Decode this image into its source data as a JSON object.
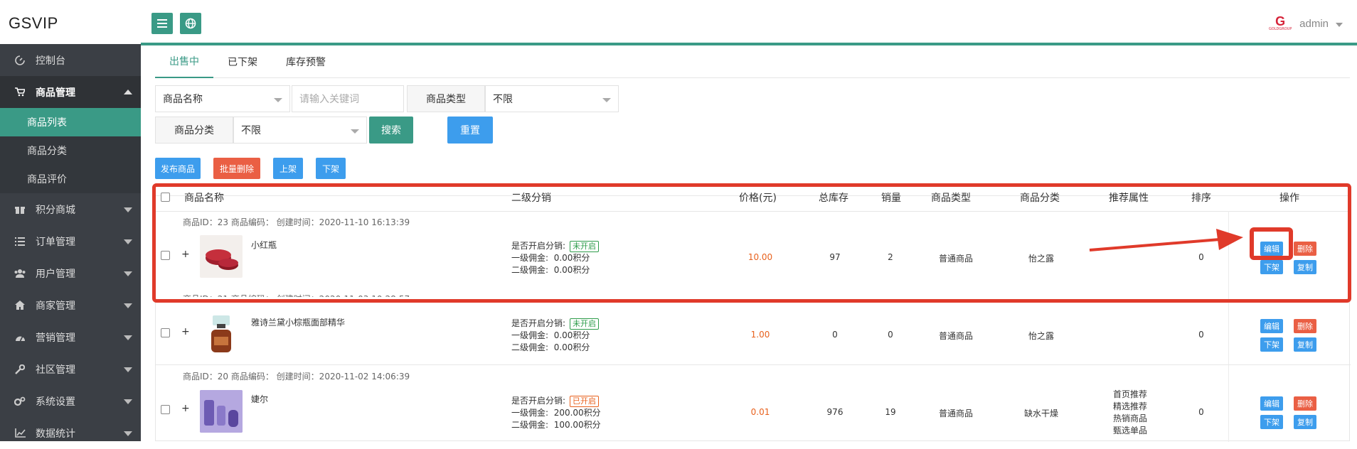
{
  "app": {
    "logo": "GSVIP"
  },
  "user": {
    "name": "admin",
    "avatar_letter": "G",
    "avatar_sub": "GOLDGROUP"
  },
  "sidebar": {
    "items": [
      {
        "label": "控制台",
        "icon": "dashboard-icon"
      },
      {
        "label": "商品管理",
        "icon": "cart-icon",
        "open": true,
        "children": [
          "商品列表",
          "商品分类",
          "商品评价"
        ]
      },
      {
        "label": "积分商城",
        "icon": "gift-icon"
      },
      {
        "label": "订单管理",
        "icon": "list-icon"
      },
      {
        "label": "用户管理",
        "icon": "users-icon"
      },
      {
        "label": "商家管理",
        "icon": "home-icon"
      },
      {
        "label": "营销管理",
        "icon": "gauge-icon"
      },
      {
        "label": "社区管理",
        "icon": "wrench-icon"
      },
      {
        "label": "系统设置",
        "icon": "gears-icon"
      },
      {
        "label": "数据统计",
        "icon": "chart-icon"
      }
    ]
  },
  "tabs": [
    "出售中",
    "已下架",
    "库存预警"
  ],
  "filters": {
    "name_select": "商品名称",
    "keyword_placeholder": "请输入关键词",
    "type_label": "商品类型",
    "type_value": "不限",
    "category_label": "商品分类",
    "category_value": "不限",
    "search": "搜索",
    "reset": "重置"
  },
  "actions": {
    "publish": "发布商品",
    "batch_delete": "批量删除",
    "on_shelf": "上架",
    "off_shelf": "下架"
  },
  "table": {
    "headers": [
      "商品名称",
      "二级分销",
      "价格(元)",
      "总库存",
      "销量",
      "商品类型",
      "商品分类",
      "推荐属性",
      "排序",
      "操作"
    ],
    "dist_labels": {
      "enabled": "是否开启分销:",
      "level1": "一级佣金:",
      "level2": "二级佣金:"
    },
    "op_labels": {
      "edit": "编辑",
      "delete": "删除",
      "off": "下架",
      "copy": "复制"
    },
    "rows": [
      {
        "meta": "商品ID：23 商品编码：    创建时间：2020-11-10 16:13:39",
        "name": "小红瓶",
        "dist_status": "未开启",
        "level1": "0.00积分",
        "level2": "0.00积分",
        "price": "10.00",
        "stock": "97",
        "sales": "2",
        "type": "普通商品",
        "category": "怡之露",
        "rec": [],
        "sort": "0"
      },
      {
        "meta": "商品ID：21 商品编码：    创建时间：2020-11-03 10:28:57",
        "name": "雅诗兰黛小棕瓶面部精华",
        "dist_status": "未开启",
        "level1": "0.00积分",
        "level2": "0.00积分",
        "price": "1.00",
        "stock": "0",
        "sales": "0",
        "type": "普通商品",
        "category": "怡之露",
        "rec": [],
        "sort": "0"
      },
      {
        "meta": "商品ID：20 商品编码：    创建时间：2020-11-02 14:06:39",
        "name": "婕尔",
        "dist_status": "已开启",
        "level1": "200.00积分",
        "level2": "100.00积分",
        "price": "0.01",
        "stock": "976",
        "sales": "19",
        "type": "普通商品",
        "category": "缺水干燥",
        "rec": [
          "首页推荐",
          "精选推荐",
          "热销商品",
          "甄选单品"
        ],
        "sort": "0"
      }
    ]
  },
  "colors": {
    "brand": "#3a9a86",
    "sidebar": "#3b3f45",
    "blue": "#3d9ded",
    "red": "#ea5f44",
    "price": "#e8611d",
    "annotation": "#e03a2a"
  }
}
